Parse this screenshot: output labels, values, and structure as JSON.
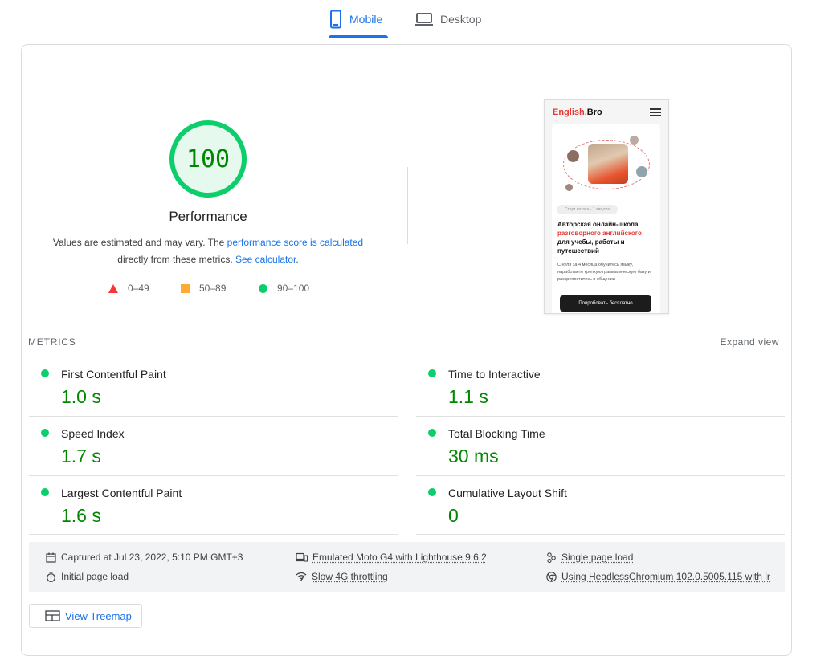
{
  "tabs": [
    {
      "label": "Mobile",
      "icon": "mobile-icon",
      "active": true
    },
    {
      "label": "Desktop",
      "icon": "desktop-icon",
      "active": false
    }
  ],
  "score": {
    "value": "100",
    "fraction": 1.0,
    "color": "#0cce6b",
    "label": "Performance"
  },
  "description": {
    "prefix": "Values are estimated and may vary. The ",
    "link1": "performance score is calculated",
    "middle": " directly from these metrics. ",
    "link2": "See calculator",
    "suffix": "."
  },
  "legend": [
    {
      "range": "0–49",
      "shape": "triangle",
      "color": "#ff3333"
    },
    {
      "range": "50–89",
      "shape": "square",
      "color": "#ffaa33"
    },
    {
      "range": "90–100",
      "shape": "circle",
      "color": "#0cce6b"
    }
  ],
  "screenshot": {
    "logo_red": "English.",
    "logo_black": "Bro",
    "badge": "Старт потока - 1 августа",
    "headline_1": "Авторская онлайн-школа",
    "headline_2": "разговорного английского",
    "headline_3": "для учебы, работы и путешествий",
    "body": "С нуля за 4 месяца обучитесь языку, наработаете крепкую грамматическую базу и раскрепоститесь в общении",
    "button": "Попробовать бесплатно"
  },
  "metrics_section": {
    "label": "METRICS",
    "expand": "Expand view"
  },
  "metrics": [
    {
      "title": "First Contentful Paint",
      "value": "1.0 s"
    },
    {
      "title": "Time to Interactive",
      "value": "1.1 s"
    },
    {
      "title": "Speed Index",
      "value": "1.7 s"
    },
    {
      "title": "Total Blocking Time",
      "value": "30 ms"
    },
    {
      "title": "Largest Contentful Paint",
      "value": "1.6 s"
    },
    {
      "title": "Cumulative Layout Shift",
      "value": "0"
    }
  ],
  "environment": {
    "captured": "Captured at Jul 23, 2022, 5:10 PM GMT+3",
    "device": "Emulated Moto G4 with Lighthouse 9.6.2",
    "session": "Single page load",
    "initial": "Initial page load",
    "throttling": "Slow 4G throttling",
    "browser": "Using HeadlessChromium 102.0.5005.115 with lr"
  },
  "treemap_button": "View Treemap",
  "colors": {
    "accent": "#1a73e8",
    "pass": "#0cce6b",
    "pass_text": "#008800"
  }
}
